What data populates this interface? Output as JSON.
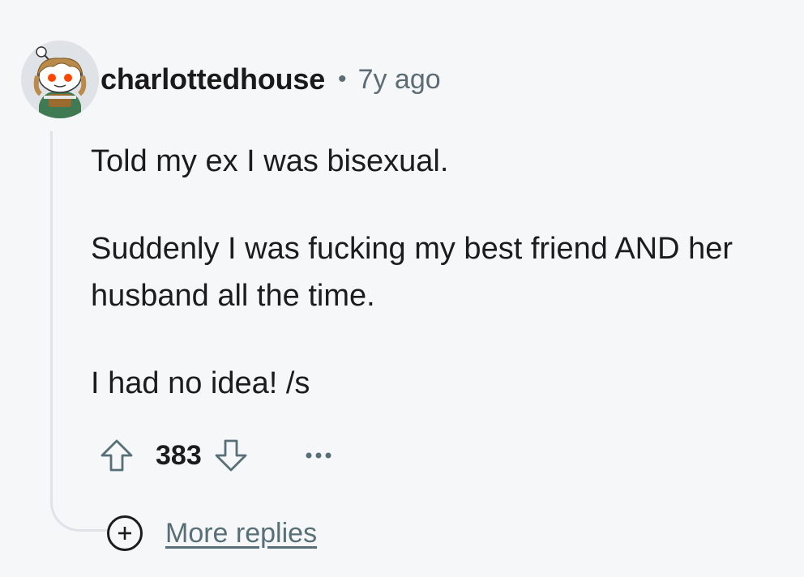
{
  "comment": {
    "avatar_icon": "snoo-avatar-icon",
    "username": "charlottedhouse",
    "separator": "•",
    "timestamp": "7y ago",
    "body": [
      "Told my ex I was bisexual.",
      "Suddenly I was fucking my best friend AND her husband all the time.",
      "I had no idea! /s"
    ],
    "score": "383",
    "actions": {
      "upvote_icon": "upvote-arrow-icon",
      "downvote_icon": "downvote-arrow-icon",
      "more_icon": "ellipsis-icon"
    }
  },
  "more_replies": {
    "icon": "plus-circle-icon",
    "label": "More replies"
  },
  "colors": {
    "background": "#f6f7f9",
    "text": "#1c1c1c",
    "meta": "#5c6c74",
    "thread_line": "#dfe3e8",
    "link": "#576f76"
  }
}
